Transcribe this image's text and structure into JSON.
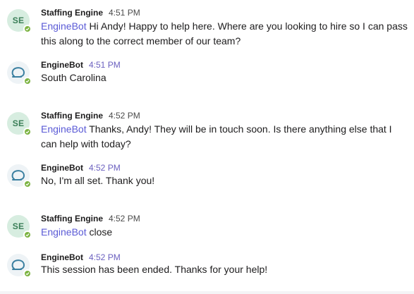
{
  "messages": [
    {
      "sender": "Staffing Engine",
      "avatar_initials": "SE",
      "time": "4:51 PM",
      "mention": "EngineBot",
      "text": "Hi Andy! Happy to help here. Where are you looking to hire so I can pass this along to the correct member of our team?"
    },
    {
      "sender": "EngineBot",
      "time": "4:51 PM",
      "text": "South Carolina"
    },
    {
      "sender": "Staffing Engine",
      "avatar_initials": "SE",
      "time": "4:52 PM",
      "mention": "EngineBot",
      "text": "Thanks, Andy! They will be in touch soon. Is there anything else that I can help with today?"
    },
    {
      "sender": "EngineBot",
      "time": "4:52 PM",
      "text": "No, I'm all set. Thank you!"
    },
    {
      "sender": "Staffing Engine",
      "avatar_initials": "SE",
      "time": "4:52 PM",
      "mention": "EngineBot",
      "text": "close"
    },
    {
      "sender": "EngineBot",
      "time": "4:52 PM",
      "text": "This session has been ended. Thanks for your help!"
    }
  ],
  "icons": {
    "bot_avatar": "enginebot-logo-icon",
    "presence": "online-check-icon"
  },
  "colors": {
    "mention": "#5a5ad6",
    "se_avatar_bg": "#d7ede0",
    "se_avatar_text": "#3b7f58",
    "online": "#7cb342",
    "bot_logo_stroke": "#3a7fa0"
  }
}
